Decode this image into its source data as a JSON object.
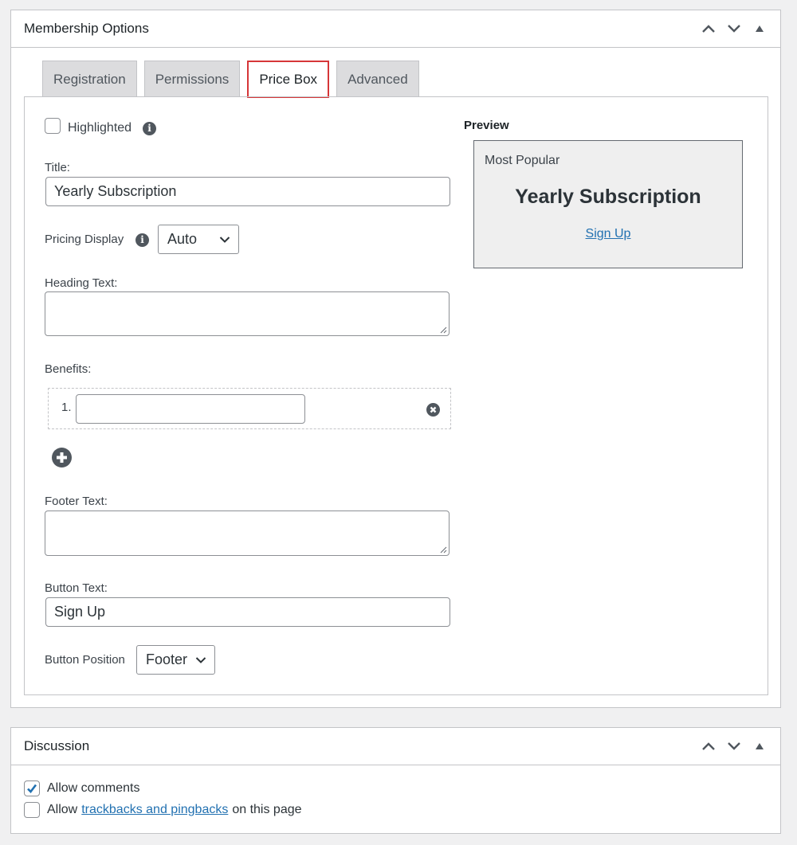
{
  "membership": {
    "title": "Membership Options",
    "header_actions": {
      "move_up": "chevron-up-icon",
      "move_down": "chevron-down-icon",
      "toggle": "triangle-up-icon"
    },
    "tabs": [
      {
        "label": "Registration",
        "active": false
      },
      {
        "label": "Permissions",
        "active": false
      },
      {
        "label": "Price Box",
        "active": true
      },
      {
        "label": "Advanced",
        "active": false
      }
    ],
    "price_box": {
      "highlighted_label": "Highlighted",
      "highlighted_checked": false,
      "title_label": "Title:",
      "title_value": "Yearly Subscription",
      "pricing_display_label": "Pricing Display",
      "pricing_display_value": "Auto",
      "heading_text_label": "Heading Text:",
      "heading_text_value": "",
      "benefits_label": "Benefits:",
      "benefits": [
        {
          "number": "1.",
          "value": ""
        }
      ],
      "footer_text_label": "Footer Text:",
      "footer_text_value": "",
      "button_text_label": "Button Text:",
      "button_text_value": "Sign Up",
      "button_position_label": "Button Position",
      "button_position_value": "Footer"
    },
    "preview": {
      "heading": "Preview",
      "tag": "Most Popular",
      "title": "Yearly Subscription",
      "link": "Sign Up"
    }
  },
  "discussion": {
    "title": "Discussion",
    "allow_comments_label": "Allow comments",
    "allow_comments_checked": true,
    "allow_pings_prefix": "Allow",
    "allow_pings_link": "trackbacks and pingbacks",
    "allow_pings_suffix": "on this page",
    "allow_pings_checked": false
  },
  "colors": {
    "accent_link": "#2271b1",
    "active_tab_border": "#d63638",
    "icon_gray": "#50575e"
  }
}
